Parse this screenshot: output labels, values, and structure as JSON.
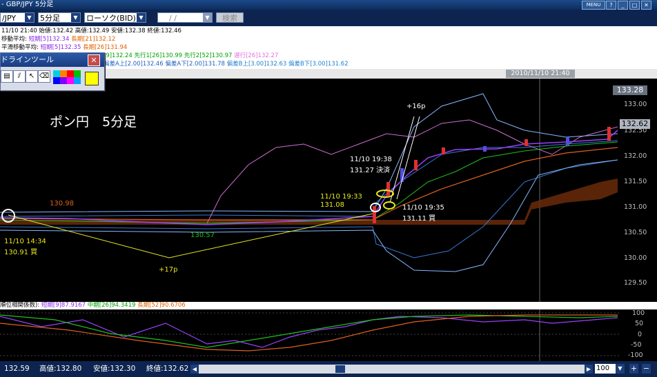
{
  "window": {
    "title": "- GBP/JPY 5分足",
    "menu_label": "MENU"
  },
  "toolbar": {
    "pair": "/JPY",
    "interval": "5分足",
    "chart_type": "ローソク(BID)",
    "date_placeholder": "/  /",
    "search_label": "検索"
  },
  "info": {
    "ohlc": "11/10 21:40 始値:132.42 高値:132.49 安値:132.38 終値:132.46",
    "ma_label": "移動平均:",
    "ma_short": "短期[5]132.34",
    "ma_long": "長期[21]132.12",
    "ma2_label": "平滑移動平均:",
    "ma2_short": "短期[5]132.35",
    "ma2_long": "長期[26]131.94",
    "ichimoku": "[9]132.24 先行1[26]130.99 先行2[52]130.97",
    "ichimoku_chikou": "遅行[26]132.27",
    "bb": "偏差A上[2.00]132.46 偏差A下[2.00]131.78",
    "bb2": "偏差B上[3.00]132.63 偏差B下[3.00]131.62"
  },
  "drawtool": {
    "title": "ドラインツール",
    "colors": [
      "#00d0e0",
      "#ff8000",
      "#ff0000",
      "#00c000",
      "#0000ff",
      "#8000ff",
      "#ff00ff",
      "#00a0ff"
    ],
    "selected_color": "#ffff00"
  },
  "chart": {
    "date_marker": "2010/11/10 21:40",
    "price_tag_current": "133.28",
    "price_tag_last": "132.62",
    "y_ticks": [
      "133.00",
      "132.50",
      "132.00",
      "131.50",
      "131.00",
      "130.50",
      "130.00",
      "129.50"
    ],
    "title_jp": "ポン円　5分足",
    "label_13098": "130.98",
    "label_13057": "130.57",
    "buy1_time": "11/10 14:34",
    "buy1_price": "130.91 買",
    "gain1": "+17p",
    "mid_time": "11/10  19:33",
    "mid_price": "131.08",
    "close_time": "11/10  19:38",
    "close_price": "131.27  決済",
    "buy2_time": "11/10  19:35",
    "buy2_price": "131.11  買",
    "gain2": "+16p"
  },
  "chart_data": {
    "type": "line",
    "title": "ポン円　5分足",
    "y_ticks": [
      133.0,
      132.5,
      132.0,
      131.5,
      131.0,
      130.5,
      130.0,
      129.5
    ],
    "series": [
      {
        "name": "短期[5]",
        "values": [
          131.0,
          130.98,
          130.9,
          130.85,
          130.8,
          130.7,
          130.72,
          130.75,
          130.8,
          130.9,
          131.0,
          131.3,
          131.7,
          132.0,
          132.1,
          132.05,
          132.1,
          132.2,
          132.3,
          132.4,
          132.62
        ]
      }
    ]
  },
  "subchart": {
    "header_prefix": "順位相関係数):",
    "short": "短期[9]87.9167",
    "mid": "中期[26]94.3419",
    "long": "長期[52]90.6706",
    "y_ticks": [
      "100",
      "50",
      "0",
      "-50",
      "-100"
    ]
  },
  "status": {
    "open": "132.59",
    "high_label": "高値:132.80",
    "low_label": "安値:132.30",
    "close_label": "終値:132.62",
    "zoom": "100"
  }
}
